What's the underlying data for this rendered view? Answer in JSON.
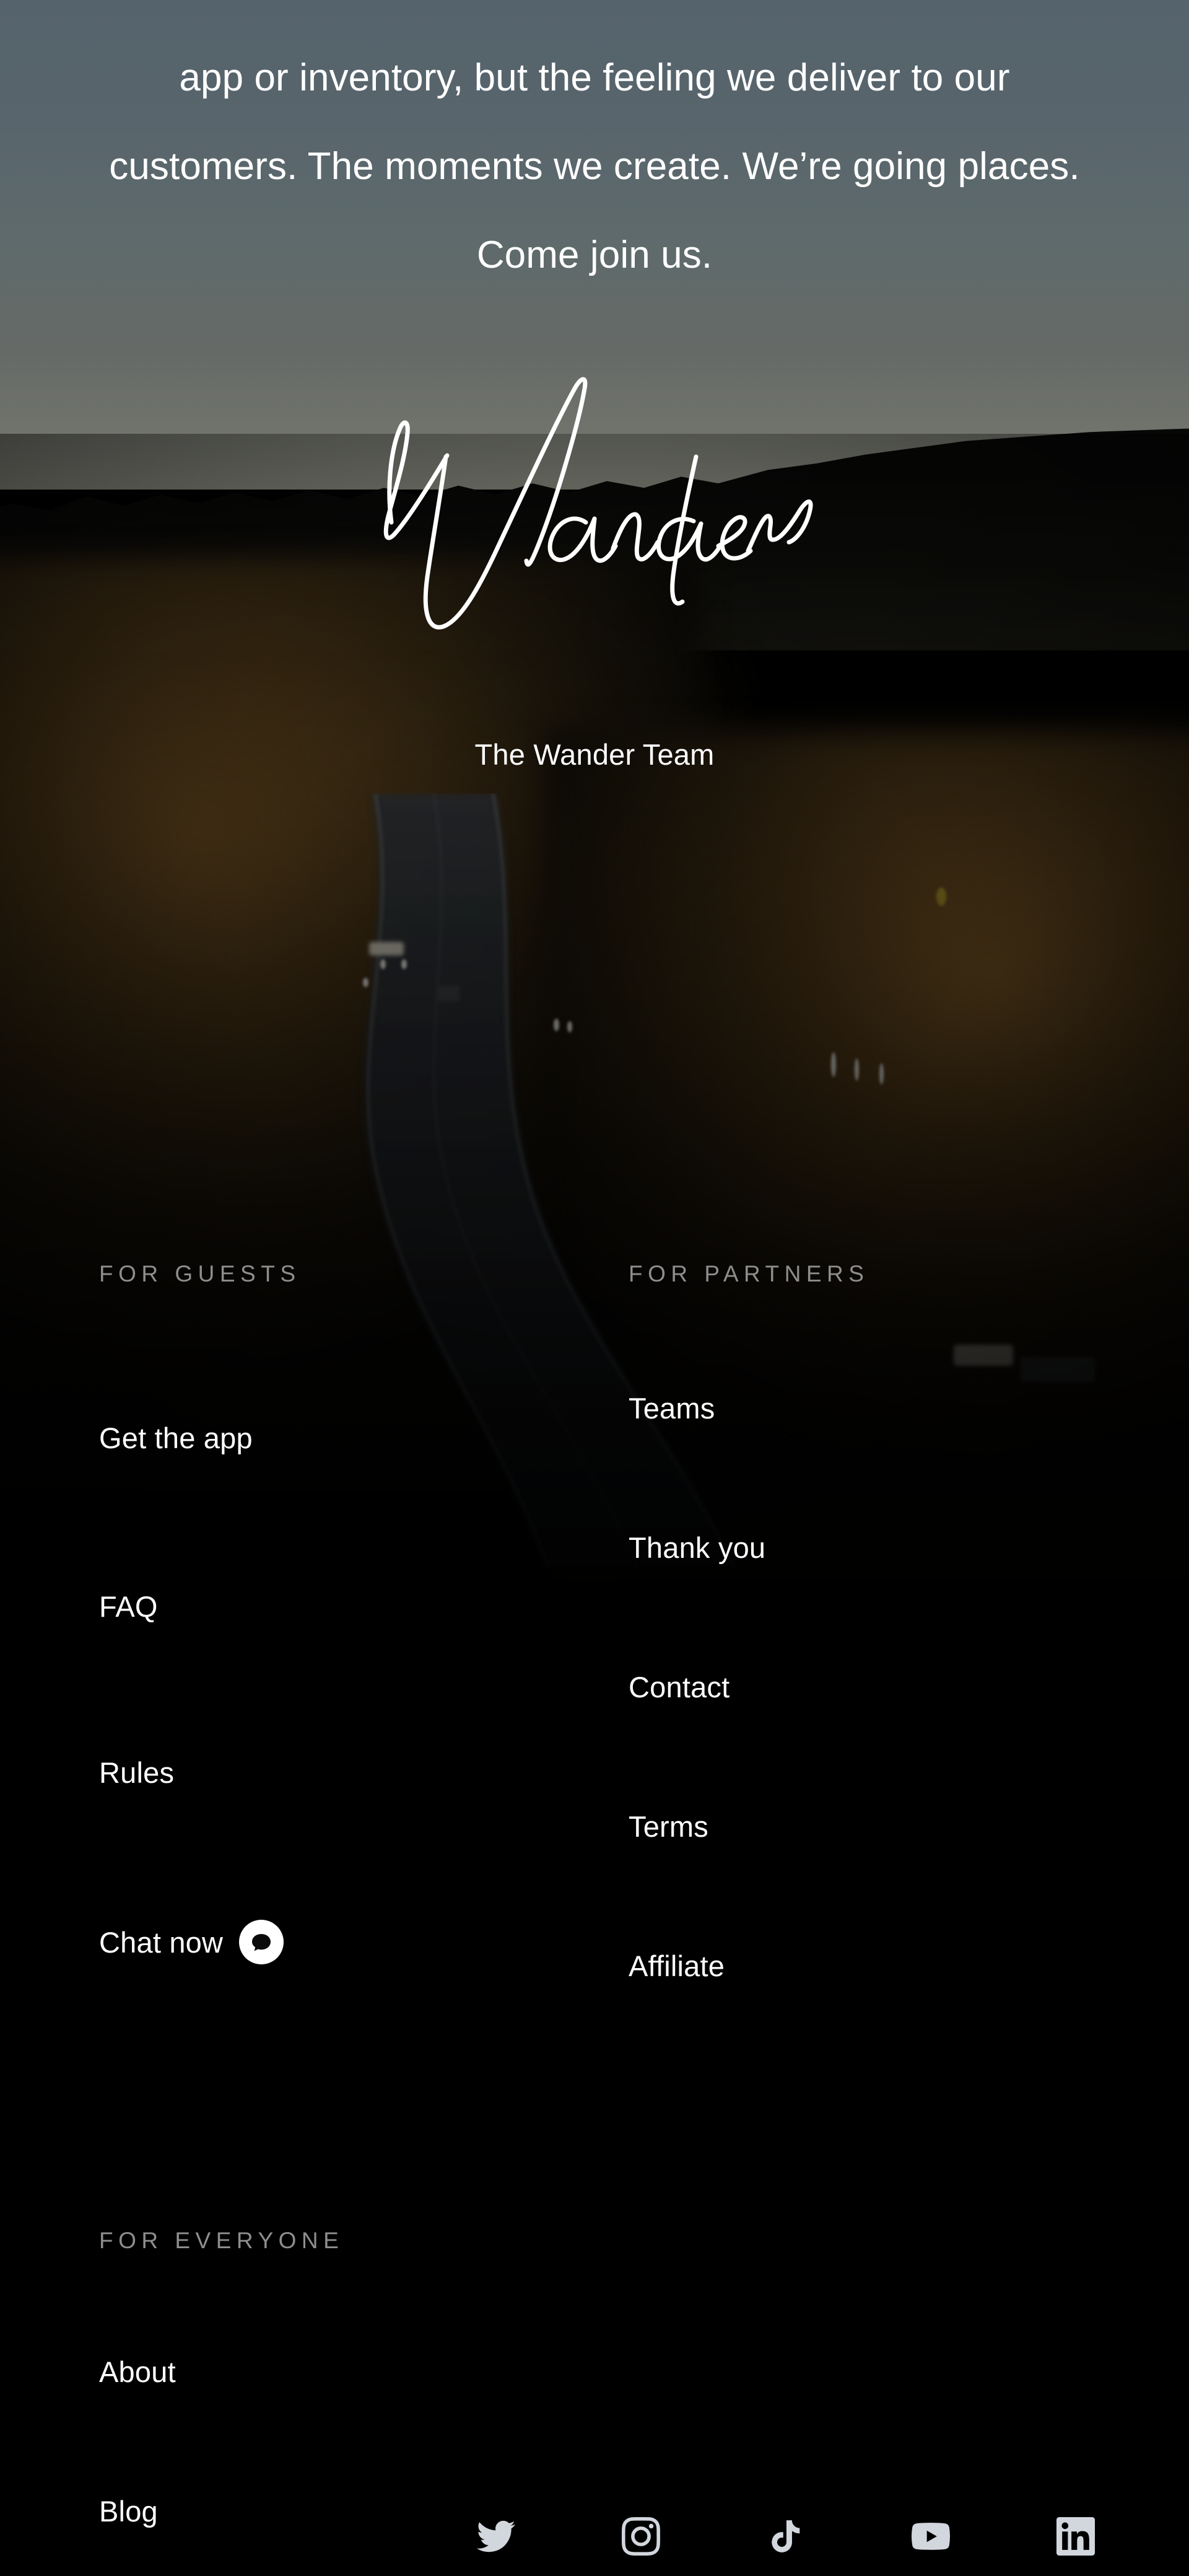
{
  "hero": {
    "paragraph": "app or inventory, but the feeling we deliver to our customers. The moments we create. We’re going places. Come join us.",
    "signoff": "The Wander Team",
    "brand_wordmark": "Wander"
  },
  "footer": {
    "columns": [
      {
        "heading": "FOR GUESTS",
        "links": [
          {
            "label": "Get the app",
            "icon": null
          },
          {
            "label": "FAQ",
            "icon": null
          },
          {
            "label": "Rules",
            "icon": null
          },
          {
            "label": "Chat now",
            "icon": "chat-bubble-icon"
          }
        ]
      },
      {
        "heading": "FOR PARTNERS",
        "links": [
          {
            "label": "Teams",
            "icon": null
          },
          {
            "label": "Thank you",
            "icon": null
          },
          {
            "label": "Contact",
            "icon": null
          },
          {
            "label": "Terms",
            "icon": null
          },
          {
            "label": "Affiliate",
            "icon": null
          }
        ]
      },
      {
        "heading": "FOR EVERYONE",
        "links": [
          {
            "label": "About",
            "icon": null
          },
          {
            "label": "Blog",
            "icon": null
          }
        ]
      }
    ],
    "social": [
      {
        "name": "twitter-icon",
        "label": "Twitter"
      },
      {
        "name": "instagram-icon",
        "label": "Instagram"
      },
      {
        "name": "tiktok-icon",
        "label": "TikTok"
      },
      {
        "name": "youtube-icon",
        "label": "YouTube"
      },
      {
        "name": "linkedin-icon",
        "label": "LinkedIn"
      }
    ]
  },
  "colors": {
    "sky_top": "#55636d",
    "sky_horizon": "#7b7c72",
    "page_background": "#000000",
    "text_primary": "#ffffff",
    "heading_muted": "#8e8e8e",
    "social_icon": "#d2d6dd",
    "chat_badge_background": "#ffffff"
  }
}
